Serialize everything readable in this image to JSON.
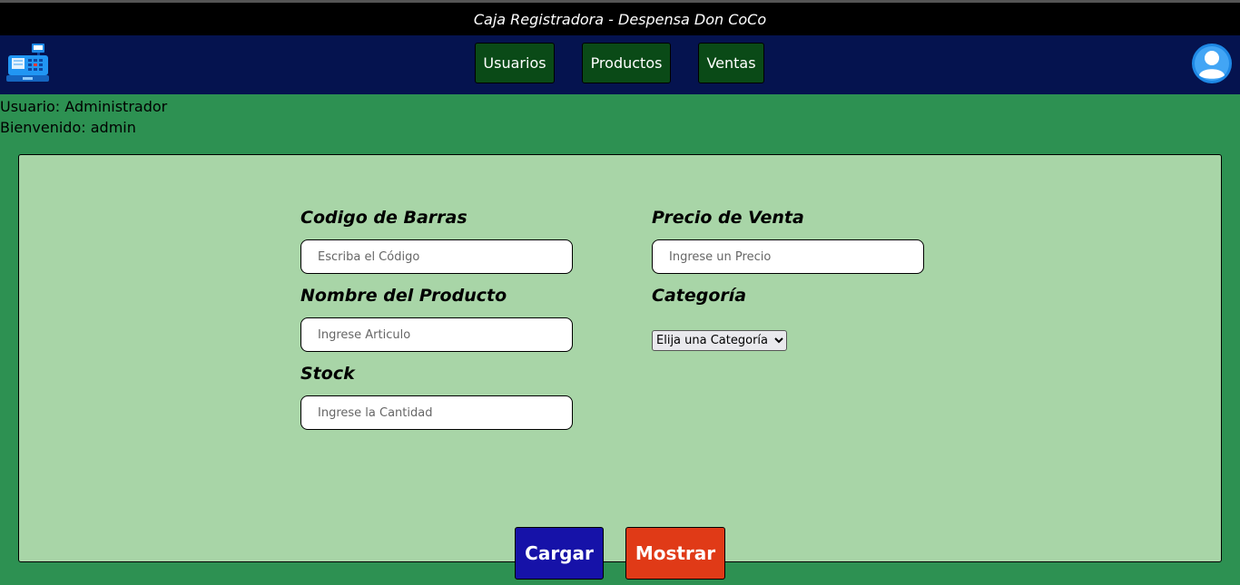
{
  "window": {
    "title": "Caja Registradora - Despensa Don CoCo"
  },
  "nav": {
    "items": [
      {
        "label": "Usuarios"
      },
      {
        "label": "Productos"
      },
      {
        "label": "Ventas"
      }
    ]
  },
  "user": {
    "role_line": "Usuario: Administrador",
    "welcome_line": "Bienvenido: admin"
  },
  "form": {
    "barcode": {
      "label": "Codigo de Barras",
      "placeholder": "Escriba el Código",
      "value": ""
    },
    "name": {
      "label": "Nombre del Producto",
      "placeholder": "Ingrese Articulo",
      "value": ""
    },
    "stock": {
      "label": "Stock",
      "placeholder": "Ingrese la Cantidad",
      "value": ""
    },
    "price": {
      "label": "Precio de Venta",
      "placeholder": "Ingrese un Precio",
      "value": ""
    },
    "category": {
      "label": "Categoría",
      "selected": "Elija una Categoría"
    }
  },
  "actions": {
    "load_label": "Cargar",
    "show_label": "Mostrar"
  },
  "colors": {
    "background": "#2d9152",
    "navbar": "#05134f",
    "panel": "#a8d5a7",
    "nav_button": "#0a4a17",
    "load_button": "#1612a8",
    "show_button": "#e03a17"
  },
  "icons": {
    "logo": "cash-register-icon",
    "profile": "user-avatar-icon",
    "select_arrow": "chevron-down-icon"
  }
}
